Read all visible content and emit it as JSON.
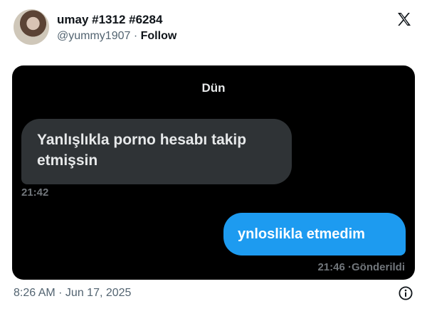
{
  "tweet": {
    "author_name": "umay #1312 #6284",
    "author_handle": "@yummy1907",
    "separator": "·",
    "follow_label": "Follow",
    "timestamp": "8:26 AM · Jun 17, 2025"
  },
  "icons": {
    "brand": "x-logo-icon",
    "info": "info-icon"
  },
  "chat": {
    "day_label": "Dün",
    "messages": [
      {
        "direction": "incoming",
        "text": "Yanlışlıkla porno hesabı takip etmişsin",
        "time": "21:42"
      },
      {
        "direction": "outgoing",
        "text": "ynloslikla etmedim",
        "time": "21:46",
        "status": "Gönderildi"
      }
    ]
  },
  "colors": {
    "chat_background": "#000000",
    "incoming_bubble": "#2f3336",
    "outgoing_bubble": "#1d9bf0",
    "meta_text": "#71767b"
  }
}
